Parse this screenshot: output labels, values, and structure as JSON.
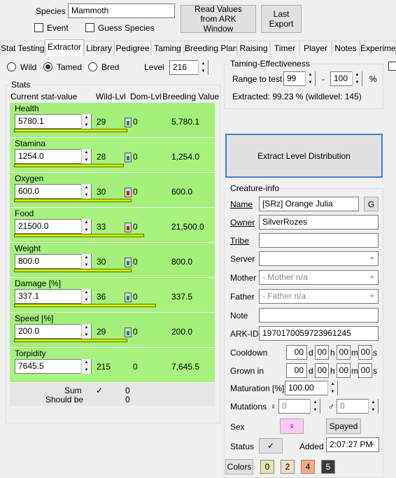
{
  "top": {
    "species_label": "Species",
    "species_value": "Mammoth",
    "event_label": "Event",
    "guess_species_label": "Guess Species",
    "read_values_button": "Read Values from ARK Window",
    "last_export_button": "Last Export"
  },
  "tabs": [
    "Stat Testing",
    "Extractor",
    "Library",
    "Pedigree",
    "Taming",
    "Breeding Plan",
    "Raising",
    "Timer",
    "Player",
    "Notes",
    "Experimen"
  ],
  "active_tab": "Extractor",
  "mode": {
    "wild_label": "Wild",
    "tamed_label": "Tamed",
    "bred_label": "Bred",
    "selected": "Tamed",
    "level_label": "Level",
    "level_value": "216"
  },
  "stats": {
    "title": "Stats",
    "headers": {
      "current": "Current stat-value",
      "wild": "Wild-Lvl",
      "dom": "Dom-Lvl",
      "breeding": "Breeding Value"
    },
    "rows": [
      {
        "name": "Health",
        "value": "5780.1",
        "wild": "29",
        "dom": "0",
        "breeding": "5,780.1",
        "bar": 0.56,
        "lock": "#2b8a3e"
      },
      {
        "name": "Stamina",
        "value": "1254.0",
        "wild": "28",
        "dom": "0",
        "breeding": "1,254.0",
        "bar": 0.54,
        "lock": "#2b8a3e"
      },
      {
        "name": "Oxygen",
        "value": "600.0",
        "wild": "30",
        "dom": "0",
        "breeding": "600.0",
        "bar": 0.58,
        "lock": "#e01010"
      },
      {
        "name": "Food",
        "value": "21500.0",
        "wild": "33",
        "dom": "0",
        "breeding": "21,500.0",
        "bar": 0.64,
        "lock": "#e01010"
      },
      {
        "name": "Weight",
        "value": "800.0",
        "wild": "30",
        "dom": "0",
        "breeding": "800.0",
        "bar": 0.58,
        "lock": "#2b8a3e"
      },
      {
        "name": "Damage [%]",
        "value": "337.1",
        "wild": "36",
        "dom": "0",
        "breeding": "337.5",
        "bar": 0.7,
        "lock": "#2b8a3e"
      },
      {
        "name": "Speed [%]",
        "value": "200.0",
        "wild": "29",
        "dom": "0",
        "breeding": "200.0",
        "bar": 0.56,
        "lock": "#2b8a3e"
      },
      {
        "name": "Torpidity",
        "value": "7645.5",
        "wild": "215",
        "dom": "0",
        "breeding": "7,645.5",
        "bar": 0,
        "lock": ""
      }
    ],
    "sum_label": "Sum",
    "sum_check": "✓",
    "sum_value": "0",
    "should_be_label": "Should be",
    "should_be_value": "0"
  },
  "taming": {
    "title": "Taming-Effectiveness",
    "range_label": "Range to test",
    "range_from": "99",
    "range_dash": "-",
    "range_to": "100",
    "range_unit": "%",
    "extracted": "Extracted: 99.23 % (wildlevel: 145)"
  },
  "extract_button": "Extract Level Distribution",
  "creature": {
    "title": "Creature-info",
    "name_label": "Name",
    "name_value": "[SRz] Orange Julia",
    "name_gen_button": "G",
    "owner_label": "Owner",
    "owner_value": "SilverRozes",
    "tribe_label": "Tribe",
    "tribe_value": "",
    "server_label": "Server",
    "server_value": "",
    "mother_label": "Mother",
    "mother_value": "- Mother n/a",
    "father_label": "Father",
    "father_value": "- Father n/a",
    "note_label": "Note",
    "note_value": "",
    "arkid_label": "ARK-ID",
    "arkid_value": "1970170059723961245",
    "cooldown_label": "Cooldown",
    "grownin_label": "Grown in",
    "time_d": "d",
    "time_h": "h",
    "time_m": "m",
    "time_s": "s",
    "time_value": "00",
    "maturation_label": "Maturation [%]",
    "maturation_value": "100.00",
    "mutations_label": "Mutations",
    "female_symbol": "♀",
    "male_symbol": "♂",
    "mut_female": "0",
    "mut_male": "0",
    "sex_label": "Sex",
    "sex_value": "♀",
    "spayed_button": "Spayed",
    "status_label": "Status",
    "status_value": "✓",
    "added_label": "Added",
    "added_value": "2:07:27 PM",
    "colors_button": "Colors",
    "color_swatches": [
      {
        "label": "0",
        "color": "#e6e3b6"
      },
      {
        "label": "2",
        "color": "#f0e0c8"
      },
      {
        "label": "4",
        "color": "#f7a97e"
      },
      {
        "label": "5",
        "color": "#3a3a3a"
      }
    ]
  }
}
